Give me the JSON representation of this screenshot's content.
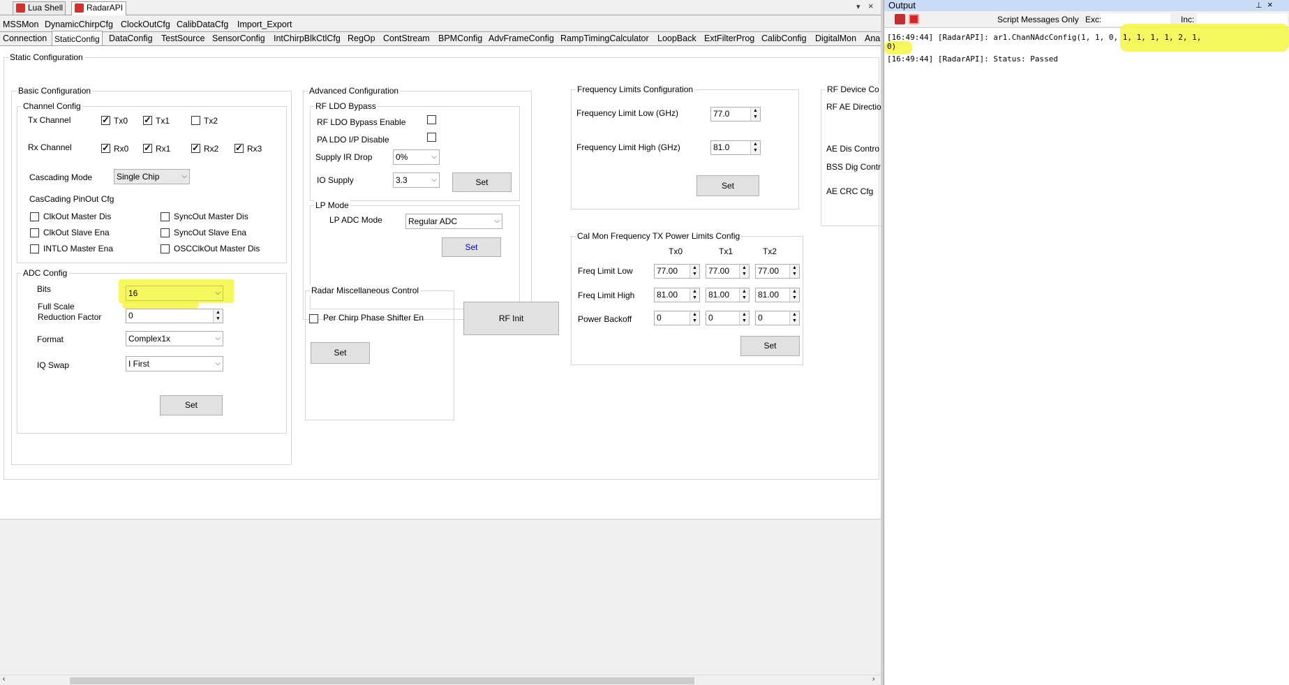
{
  "panel_tabs": [
    {
      "label": "Lua Shell"
    },
    {
      "label": "RadarAPI"
    }
  ],
  "win_buttons": [
    "▾",
    "×"
  ],
  "tabs_row1": [
    "MSSMon",
    "DynamicChirpCfg",
    "ClockOutCfg",
    "CalibDataCfg",
    "Import_Export"
  ],
  "tabs_row2": [
    "Connection",
    "StaticConfig",
    "DataConfig",
    "TestSource",
    "SensorConfig",
    "IntChirpBlkCtlCfg",
    "RegOp",
    "ContStream",
    "BPMConfig",
    "AdvFrameConfig",
    "RampTimingCalculator",
    "LoopBack",
    "ExtFilterProg",
    "CalibConfig",
    "DigitalMon",
    "Anal"
  ],
  "static_title": "Static Configuration",
  "basic": {
    "title": "Basic Configuration",
    "channel_title": "Channel Config",
    "tx_label": "Tx Channel",
    "rx_label": "Rx Channel",
    "tx": [
      {
        "label": "Tx0",
        "checked": true
      },
      {
        "label": "Tx1",
        "checked": true
      },
      {
        "label": "Tx2",
        "checked": false
      }
    ],
    "rx": [
      {
        "label": "Rx0",
        "checked": true
      },
      {
        "label": "Rx1",
        "checked": true
      },
      {
        "label": "Rx2",
        "checked": true
      },
      {
        "label": "Rx3",
        "checked": true
      }
    ],
    "cascading_label": "Cascading Mode",
    "cascading_value": "Single Chip",
    "pinout_title": "CasCading PinOut Cfg",
    "pinout": [
      "ClkOut Master Dis",
      "SyncOut Master Dis",
      "ClkOut Slave Ena",
      "SyncOut Slave Ena",
      "INTLO Master Ena",
      "OSCClkOut Master Dis"
    ],
    "adc_title": "ADC Config",
    "bits_label": "Bits",
    "bits_value": "16",
    "fsrf_label1": "Full Scale",
    "fsrf_label2": "Reduction Factor",
    "fsrf_value": "0",
    "format_label": "Format",
    "format_value": "Complex1x",
    "iq_label": "IQ Swap",
    "iq_value": "I First",
    "set": "Set"
  },
  "advanced": {
    "title": "Advanced Configuration",
    "ldo_title": "RF LDO Bypass",
    "ldo_enable": "RF LDO Bypass Enable",
    "pa_ldo": "PA LDO I/P Disable",
    "supply_ir_label": "Supply IR Drop",
    "supply_ir_value": "0%",
    "io_supply_label": "IO Supply",
    "io_supply_value": "3.3",
    "set": "Set",
    "lp_title": "LP Mode",
    "lp_adc_label": "LP ADC Mode",
    "lp_adc_value": "Regular ADC",
    "lp_set": "Set"
  },
  "misc": {
    "title": "Radar Miscellaneous Control",
    "phase_shifter": "Per Chirp Phase Shifter En",
    "set": "Set",
    "rf_init": "RF Init"
  },
  "freq": {
    "title": "Frequency Limits Configuration",
    "low_label": "Frequency Limit Low (GHz)",
    "low_value": "77.0",
    "high_label": "Frequency Limit High (GHz)",
    "high_value": "81.0",
    "set": "Set"
  },
  "calmon": {
    "title": "Cal Mon Frequency TX Power Limits Config",
    "cols": [
      "Tx0",
      "Tx1",
      "Tx2"
    ],
    "rows": [
      {
        "label": "Freq Limit Low",
        "values": [
          "77.00",
          "77.00",
          "77.00"
        ]
      },
      {
        "label": "Freq Limit High",
        "values": [
          "81.00",
          "81.00",
          "81.00"
        ]
      },
      {
        "label": "Power Backoff",
        "values": [
          "0",
          "0",
          "0"
        ]
      }
    ],
    "set": "Set"
  },
  "rfdevice": {
    "title": "RF Device Co",
    "items": [
      "RF AE Directio",
      "AE Dis Contro",
      "BSS Dig Contr",
      "AE CRC Cfg"
    ]
  },
  "output": {
    "title": "Output",
    "pin": "⊥",
    "close": "×",
    "script_only": "Script Messages Only",
    "exc": "Exc:",
    "inc": "Inc:",
    "lines": [
      "[16:49:44]  [RadarAPI]: ar1.ChanNAdcConfig(1, 1, 0, 1, 1, 1, 1, 2, 1,",
      "0)",
      "[16:49:44]  [RadarAPI]: Status: Passed"
    ]
  },
  "colors": {
    "highlight": "#f5f542",
    "title_bg": "#c8ddf5"
  }
}
